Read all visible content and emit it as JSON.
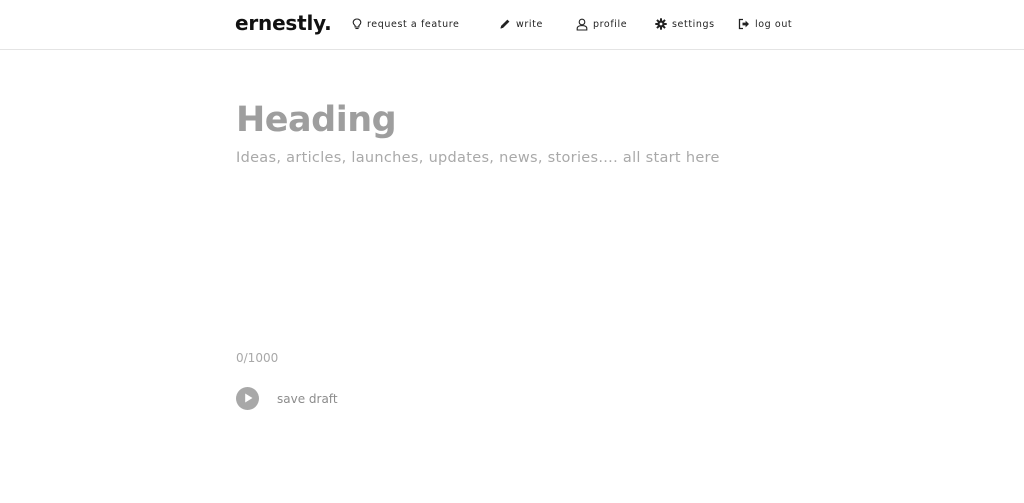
{
  "header": {
    "logo": "ernestly.",
    "nav": {
      "request_feature": "request a feature",
      "write": "write",
      "profile": "profile",
      "settings": "settings",
      "logout": "log out"
    }
  },
  "editor": {
    "heading_placeholder": "Heading",
    "body_placeholder": "Ideas, articles, launches, updates, news, stories.... all start here",
    "char_count": "0/1000",
    "save_label": "save draft"
  },
  "colors": {
    "placeholder": "#9e9e9e",
    "button": "#a8a8a8",
    "divider": "#e4e4e4"
  },
  "icons": {
    "request_feature": "lightbulb-icon",
    "write": "pencil-icon",
    "profile": "user-icon",
    "settings": "gear-icon",
    "logout": "log-out-icon",
    "save": "play-icon"
  }
}
